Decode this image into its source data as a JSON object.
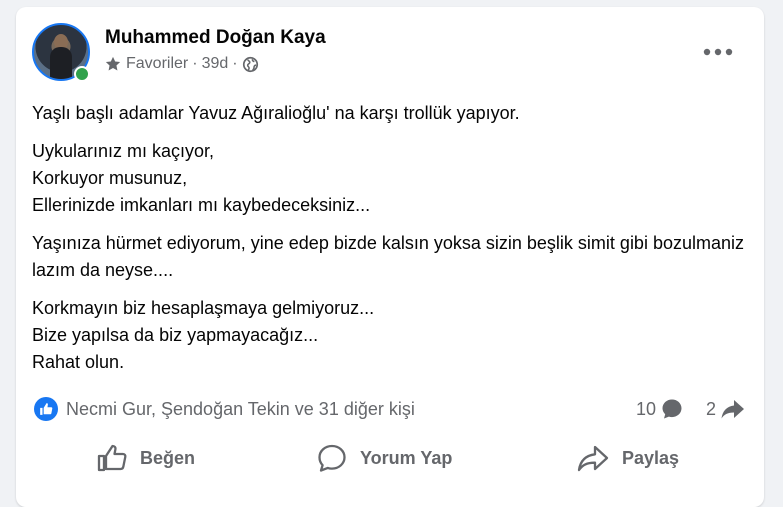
{
  "post": {
    "author": "Muhammed Doğan Kaya",
    "audience": "Favoriler",
    "separator": "·",
    "time": "39d",
    "separator2": "·",
    "paragraphs": [
      "Yaşlı başlı adamlar Yavuz Ağıralioğlu' na karşı trollük yapıyor.",
      "Uykularınız mı kaçıyor,\nKorkuyor musunuz,\nEllerinizde imkanları mı kaybedeceksiniz...",
      "Yaşınıza hürmet ediyorum, yine edep bizde kalsın yoksa sizin beşlik simit gibi bozulmaniz lazım da neyse....",
      "Korkmayın biz hesaplaşmaya gelmiyoruz...\nBize yapılsa da biz yapmayacağız...\nRahat olun."
    ]
  },
  "reactions": {
    "icon": "like-icon",
    "summary": "Necmi Gur, Şendoğan Tekin ve 31 diğer kişi",
    "comment_count": "10",
    "share_count": "2"
  },
  "actions": {
    "like_label": "Beğen",
    "comment_label": "Yorum Yap",
    "share_label": "Paylaş"
  },
  "colors": {
    "accent": "#1877f2",
    "online": "#31a24c",
    "muted": "#65676b"
  }
}
